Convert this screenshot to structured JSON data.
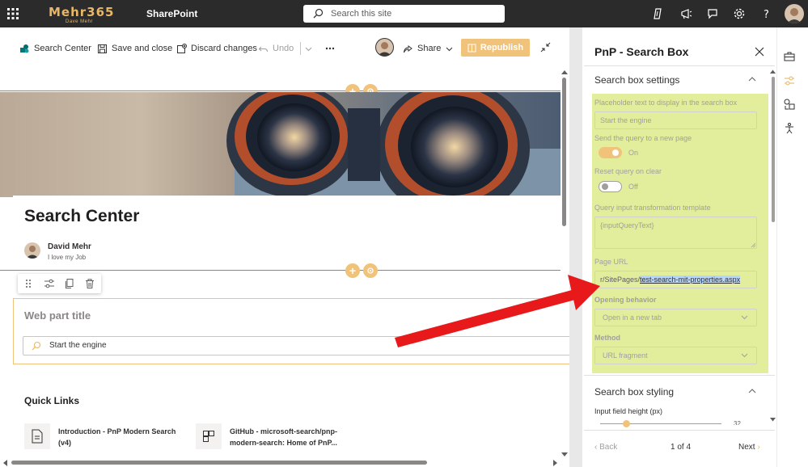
{
  "suite": {
    "brand": "Mehr365",
    "brand_sub": "Dave Mehr",
    "app": "SharePoint",
    "search_placeholder": "Search this site"
  },
  "commandbar": {
    "search_center": "Search Center",
    "save_close": "Save and close",
    "discard": "Discard changes",
    "undo": "Undo",
    "share": "Share",
    "republish": "Republish"
  },
  "page": {
    "title": "Search Center",
    "author_name": "David Mehr",
    "author_desc": "I love my Job"
  },
  "webpart": {
    "title_placeholder": "Web part title",
    "search_text": "Start the engine"
  },
  "quicklinks": {
    "title": "Quick Links",
    "items": [
      {
        "line1": "Introduction - PnP Modern Search",
        "line2": "(v4)"
      },
      {
        "line1": "GitHub - microsoft-search/pnp-",
        "line2": "modern-search: Home of PnP..."
      }
    ]
  },
  "pane": {
    "title": "PnP - Search Box",
    "group1": "Search box settings",
    "placeholder_label": "Placeholder text to display in the search box",
    "placeholder_value": "Start the engine",
    "send_query_label": "Send the query to a new page",
    "send_query_state": "On",
    "reset_label": "Reset query on clear",
    "reset_state": "Off",
    "template_label": "Query input transformation template",
    "template_value": "{inputQueryText}",
    "page_url_label": "Page URL",
    "page_url_prefix": "r/SitePages/",
    "page_url_selected": "test-search-mit-properties.aspx",
    "opening_label": "Opening behavior",
    "opening_value": "Open in a new tab",
    "method_label": "Method",
    "method_value": "URL fragment",
    "group2": "Search box styling",
    "input_height_label": "Input field height (px)",
    "input_height_value": "32",
    "back": "Back",
    "page_of": "1 of 4",
    "next": "Next"
  },
  "colors": {
    "accent": "#f0c27a",
    "highlight": "#e2ee9c",
    "arrow": "#e8191a",
    "suitebar": "#2b2b2b"
  }
}
